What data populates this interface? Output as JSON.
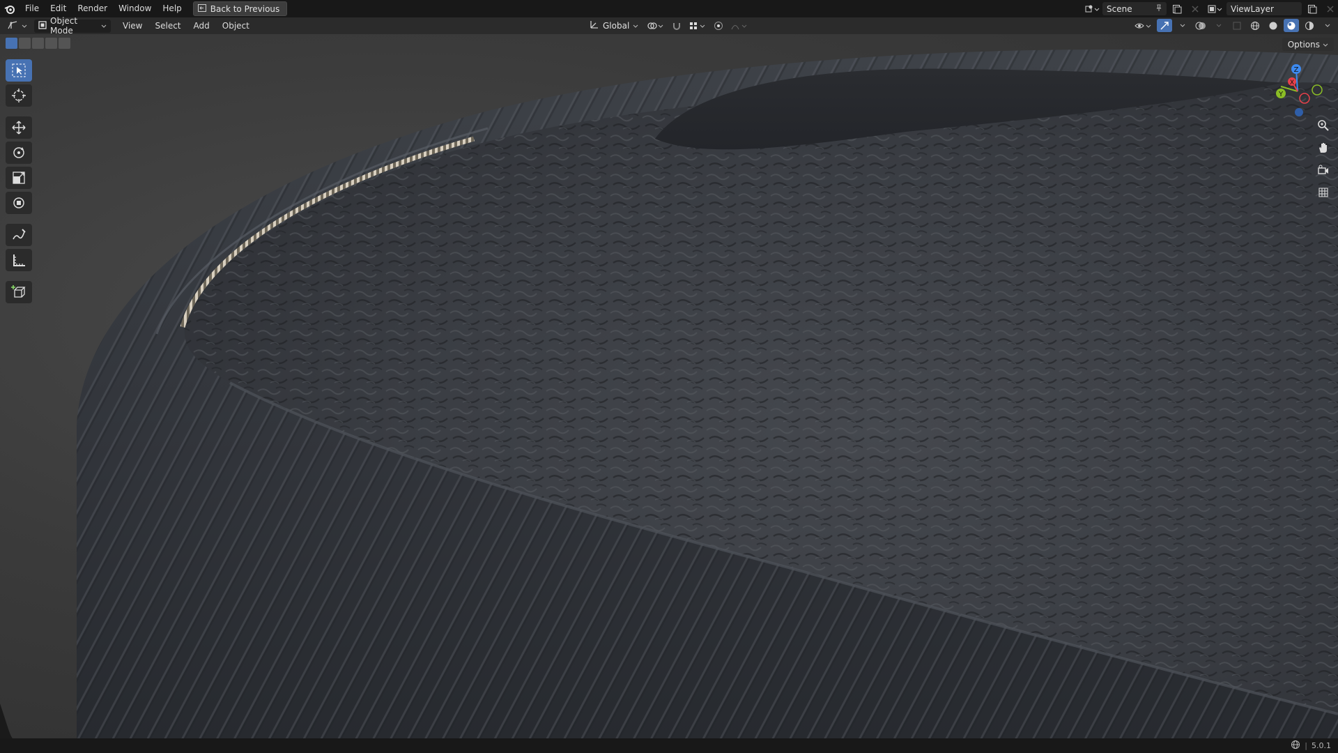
{
  "menu": {
    "items": [
      "File",
      "Edit",
      "Render",
      "Window",
      "Help"
    ],
    "back_label": "Back to Previous"
  },
  "top_right": {
    "scene_name": "Scene",
    "view_layer": "ViewLayer"
  },
  "header": {
    "mode_label": "Object Mode",
    "menus": [
      "View",
      "Select",
      "Add",
      "Object"
    ],
    "transform_orientation": "Global"
  },
  "viewport": {
    "options_label": "Options",
    "gizmo_axes": {
      "x": "X",
      "y": "Y",
      "z": "Z"
    }
  },
  "toolbar": {
    "tools": [
      "select-box-icon",
      "cursor-icon",
      "move-icon",
      "rotate-icon",
      "scale-icon",
      "transform-icon",
      "annotate-icon",
      "measure-icon",
      "add-cube-icon"
    ],
    "active_tool": "select-box-icon"
  },
  "statusbar": {
    "version": "5.0.1"
  },
  "colors": {
    "accent": "#4772b3",
    "topbar": "#181818",
    "header": "#2b2b2b",
    "axis_x": "#e8414b",
    "axis_y": "#8bbd26",
    "axis_z": "#3d8af0"
  }
}
